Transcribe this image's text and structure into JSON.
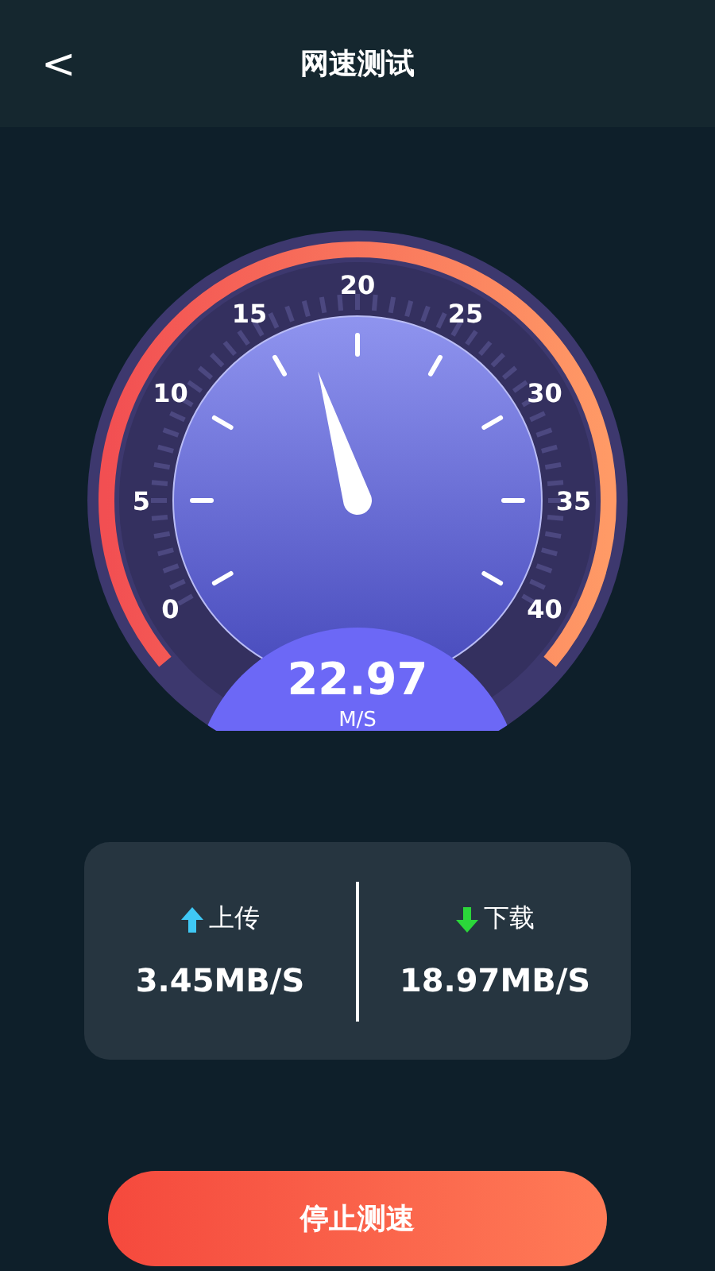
{
  "header": {
    "back": "<",
    "title": "网速测试"
  },
  "gauge": {
    "scale": [
      "0",
      "5",
      "10",
      "15",
      "20",
      "25",
      "30",
      "35",
      "40"
    ],
    "value": "22.97",
    "unit": "M/S"
  },
  "stats": [
    {
      "kind": "upload",
      "label": "上传",
      "value": "3.45MB/S",
      "color": "#3fc8f5"
    },
    {
      "kind": "download",
      "label": "下载",
      "value": "18.97MB/S",
      "color": "#2bd63a"
    }
  ],
  "button": "停止测速"
}
